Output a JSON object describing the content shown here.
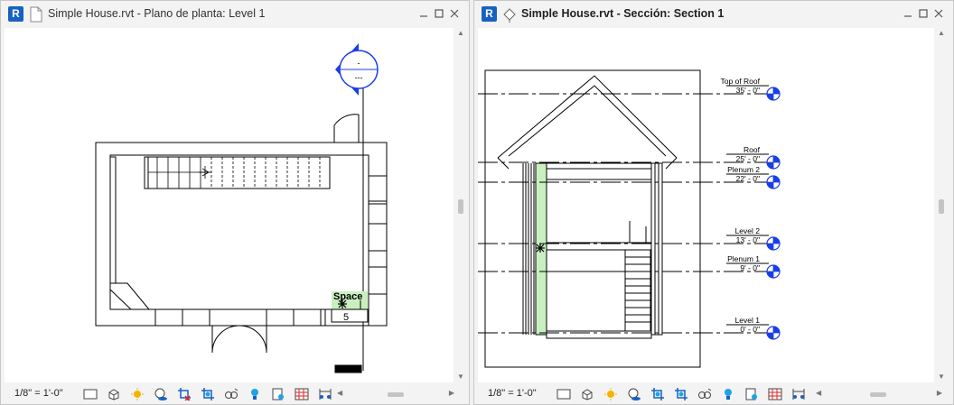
{
  "app": {
    "logo_letter": "R"
  },
  "left_view": {
    "title": "Simple House.rvt - Plano de planta: Level 1",
    "scale": "1/8\" = 1'-0\"",
    "space_tag": {
      "label": "Space",
      "number": "5"
    },
    "elevation_marker": {
      "top": "-",
      "bottom": "---"
    }
  },
  "right_view": {
    "title": "Simple House.rvt - Sección: Section 1",
    "scale": "1/8\" = 1'-0\"",
    "levels": [
      {
        "name": "Top of Roof",
        "elevation": "35' - 0\""
      },
      {
        "name": "Roof",
        "elevation": "25' - 0\""
      },
      {
        "name": "Plenum 2",
        "elevation": "22' - 0\""
      },
      {
        "name": "Level 2",
        "elevation": "13' - 0\""
      },
      {
        "name": "Plenum 1",
        "elevation": "9' - 0\""
      },
      {
        "name": "Level 1",
        "elevation": "0' - 0\""
      }
    ]
  },
  "status_icons": [
    "detail-level-icon",
    "visual-style-icon",
    "sun-path-icon",
    "shadows-icon",
    "crop-view-icon",
    "show-crop-icon",
    "temporary-hide-icon",
    "reveal-hidden-icon",
    "temporary-properties-icon",
    "worksharing-icon",
    "analytical-model-icon",
    "constraints-icon"
  ],
  "colors": {
    "revit_blue": "#1761c2",
    "marker_blue": "#1a3ee6",
    "space_green": "#c9efc1",
    "background": "#f3f3f3"
  }
}
